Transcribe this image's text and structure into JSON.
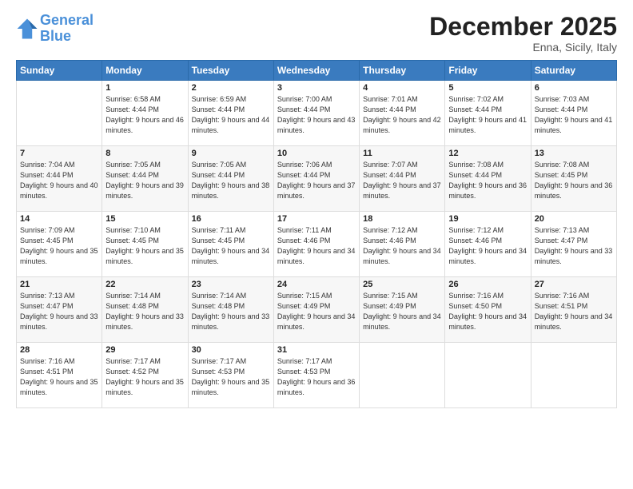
{
  "logo": {
    "line1": "General",
    "line2": "Blue"
  },
  "title": "December 2025",
  "location": "Enna, Sicily, Italy",
  "weekdays": [
    "Sunday",
    "Monday",
    "Tuesday",
    "Wednesday",
    "Thursday",
    "Friday",
    "Saturday"
  ],
  "weeks": [
    [
      {
        "day": "",
        "sunrise": "",
        "sunset": "",
        "daylight": ""
      },
      {
        "day": "1",
        "sunrise": "Sunrise: 6:58 AM",
        "sunset": "Sunset: 4:44 PM",
        "daylight": "Daylight: 9 hours and 46 minutes."
      },
      {
        "day": "2",
        "sunrise": "Sunrise: 6:59 AM",
        "sunset": "Sunset: 4:44 PM",
        "daylight": "Daylight: 9 hours and 44 minutes."
      },
      {
        "day": "3",
        "sunrise": "Sunrise: 7:00 AM",
        "sunset": "Sunset: 4:44 PM",
        "daylight": "Daylight: 9 hours and 43 minutes."
      },
      {
        "day": "4",
        "sunrise": "Sunrise: 7:01 AM",
        "sunset": "Sunset: 4:44 PM",
        "daylight": "Daylight: 9 hours and 42 minutes."
      },
      {
        "day": "5",
        "sunrise": "Sunrise: 7:02 AM",
        "sunset": "Sunset: 4:44 PM",
        "daylight": "Daylight: 9 hours and 41 minutes."
      },
      {
        "day": "6",
        "sunrise": "Sunrise: 7:03 AM",
        "sunset": "Sunset: 4:44 PM",
        "daylight": "Daylight: 9 hours and 41 minutes."
      }
    ],
    [
      {
        "day": "7",
        "sunrise": "Sunrise: 7:04 AM",
        "sunset": "Sunset: 4:44 PM",
        "daylight": "Daylight: 9 hours and 40 minutes."
      },
      {
        "day": "8",
        "sunrise": "Sunrise: 7:05 AM",
        "sunset": "Sunset: 4:44 PM",
        "daylight": "Daylight: 9 hours and 39 minutes."
      },
      {
        "day": "9",
        "sunrise": "Sunrise: 7:05 AM",
        "sunset": "Sunset: 4:44 PM",
        "daylight": "Daylight: 9 hours and 38 minutes."
      },
      {
        "day": "10",
        "sunrise": "Sunrise: 7:06 AM",
        "sunset": "Sunset: 4:44 PM",
        "daylight": "Daylight: 9 hours and 37 minutes."
      },
      {
        "day": "11",
        "sunrise": "Sunrise: 7:07 AM",
        "sunset": "Sunset: 4:44 PM",
        "daylight": "Daylight: 9 hours and 37 minutes."
      },
      {
        "day": "12",
        "sunrise": "Sunrise: 7:08 AM",
        "sunset": "Sunset: 4:44 PM",
        "daylight": "Daylight: 9 hours and 36 minutes."
      },
      {
        "day": "13",
        "sunrise": "Sunrise: 7:08 AM",
        "sunset": "Sunset: 4:45 PM",
        "daylight": "Daylight: 9 hours and 36 minutes."
      }
    ],
    [
      {
        "day": "14",
        "sunrise": "Sunrise: 7:09 AM",
        "sunset": "Sunset: 4:45 PM",
        "daylight": "Daylight: 9 hours and 35 minutes."
      },
      {
        "day": "15",
        "sunrise": "Sunrise: 7:10 AM",
        "sunset": "Sunset: 4:45 PM",
        "daylight": "Daylight: 9 hours and 35 minutes."
      },
      {
        "day": "16",
        "sunrise": "Sunrise: 7:11 AM",
        "sunset": "Sunset: 4:45 PM",
        "daylight": "Daylight: 9 hours and 34 minutes."
      },
      {
        "day": "17",
        "sunrise": "Sunrise: 7:11 AM",
        "sunset": "Sunset: 4:46 PM",
        "daylight": "Daylight: 9 hours and 34 minutes."
      },
      {
        "day": "18",
        "sunrise": "Sunrise: 7:12 AM",
        "sunset": "Sunset: 4:46 PM",
        "daylight": "Daylight: 9 hours and 34 minutes."
      },
      {
        "day": "19",
        "sunrise": "Sunrise: 7:12 AM",
        "sunset": "Sunset: 4:46 PM",
        "daylight": "Daylight: 9 hours and 34 minutes."
      },
      {
        "day": "20",
        "sunrise": "Sunrise: 7:13 AM",
        "sunset": "Sunset: 4:47 PM",
        "daylight": "Daylight: 9 hours and 33 minutes."
      }
    ],
    [
      {
        "day": "21",
        "sunrise": "Sunrise: 7:13 AM",
        "sunset": "Sunset: 4:47 PM",
        "daylight": "Daylight: 9 hours and 33 minutes."
      },
      {
        "day": "22",
        "sunrise": "Sunrise: 7:14 AM",
        "sunset": "Sunset: 4:48 PM",
        "daylight": "Daylight: 9 hours and 33 minutes."
      },
      {
        "day": "23",
        "sunrise": "Sunrise: 7:14 AM",
        "sunset": "Sunset: 4:48 PM",
        "daylight": "Daylight: 9 hours and 33 minutes."
      },
      {
        "day": "24",
        "sunrise": "Sunrise: 7:15 AM",
        "sunset": "Sunset: 4:49 PM",
        "daylight": "Daylight: 9 hours and 34 minutes."
      },
      {
        "day": "25",
        "sunrise": "Sunrise: 7:15 AM",
        "sunset": "Sunset: 4:49 PM",
        "daylight": "Daylight: 9 hours and 34 minutes."
      },
      {
        "day": "26",
        "sunrise": "Sunrise: 7:16 AM",
        "sunset": "Sunset: 4:50 PM",
        "daylight": "Daylight: 9 hours and 34 minutes."
      },
      {
        "day": "27",
        "sunrise": "Sunrise: 7:16 AM",
        "sunset": "Sunset: 4:51 PM",
        "daylight": "Daylight: 9 hours and 34 minutes."
      }
    ],
    [
      {
        "day": "28",
        "sunrise": "Sunrise: 7:16 AM",
        "sunset": "Sunset: 4:51 PM",
        "daylight": "Daylight: 9 hours and 35 minutes."
      },
      {
        "day": "29",
        "sunrise": "Sunrise: 7:17 AM",
        "sunset": "Sunset: 4:52 PM",
        "daylight": "Daylight: 9 hours and 35 minutes."
      },
      {
        "day": "30",
        "sunrise": "Sunrise: 7:17 AM",
        "sunset": "Sunset: 4:53 PM",
        "daylight": "Daylight: 9 hours and 35 minutes."
      },
      {
        "day": "31",
        "sunrise": "Sunrise: 7:17 AM",
        "sunset": "Sunset: 4:53 PM",
        "daylight": "Daylight: 9 hours and 36 minutes."
      },
      {
        "day": "",
        "sunrise": "",
        "sunset": "",
        "daylight": ""
      },
      {
        "day": "",
        "sunrise": "",
        "sunset": "",
        "daylight": ""
      },
      {
        "day": "",
        "sunrise": "",
        "sunset": "",
        "daylight": ""
      }
    ]
  ]
}
